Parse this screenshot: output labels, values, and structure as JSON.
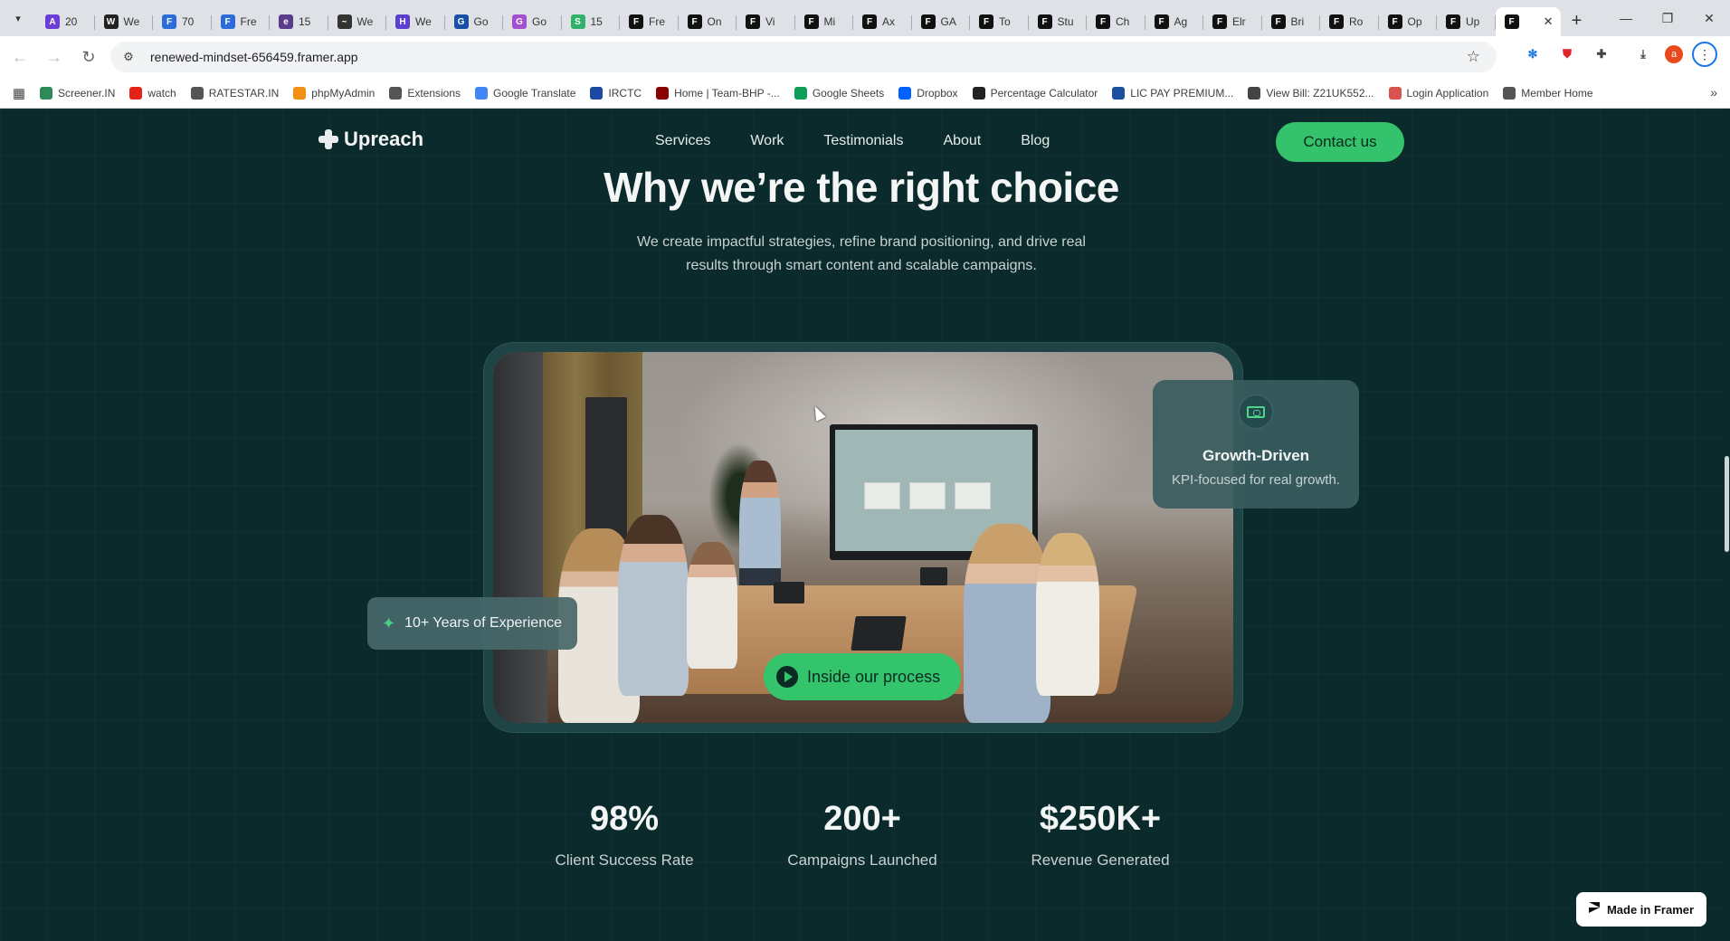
{
  "browser": {
    "tabs": [
      {
        "label": "20",
        "favicon": "A",
        "color": "#6b3fd6"
      },
      {
        "label": "We",
        "favicon": "W",
        "color": "#222222"
      },
      {
        "label": "70",
        "favicon": "F",
        "color": "#2b6cd9"
      },
      {
        "label": "Fre",
        "favicon": "F",
        "color": "#2b6cd9"
      },
      {
        "label": "15",
        "favicon": "e",
        "color": "#5a3c8a"
      },
      {
        "label": "We",
        "favicon": "~",
        "color": "#333333"
      },
      {
        "label": "We",
        "favicon": "H",
        "color": "#5b3fd0"
      },
      {
        "label": "Go",
        "favicon": "G",
        "color": "#1a4fa8"
      },
      {
        "label": "Go",
        "favicon": "G",
        "color": "#a24fd0"
      },
      {
        "label": "15",
        "favicon": "S",
        "color": "#2fb36a"
      },
      {
        "label": "Fre",
        "favicon": "F",
        "color": "#111111"
      },
      {
        "label": "On",
        "favicon": "F",
        "color": "#111111"
      },
      {
        "label": "Vi",
        "favicon": "F",
        "color": "#111111"
      },
      {
        "label": "Mi",
        "favicon": "F",
        "color": "#111111"
      },
      {
        "label": "Ax",
        "favicon": "F",
        "color": "#111111"
      },
      {
        "label": "GA",
        "favicon": "F",
        "color": "#111111"
      },
      {
        "label": "To",
        "favicon": "F",
        "color": "#111111"
      },
      {
        "label": "Stu",
        "favicon": "F",
        "color": "#111111"
      },
      {
        "label": "Ch",
        "favicon": "F",
        "color": "#111111"
      },
      {
        "label": "Ag",
        "favicon": "F",
        "color": "#111111"
      },
      {
        "label": "Elr",
        "favicon": "F",
        "color": "#111111"
      },
      {
        "label": "Bri",
        "favicon": "F",
        "color": "#111111"
      },
      {
        "label": "Ro",
        "favicon": "F",
        "color": "#111111"
      },
      {
        "label": "Op",
        "favicon": "F",
        "color": "#111111"
      },
      {
        "label": "Up",
        "favicon": "F",
        "color": "#111111"
      }
    ],
    "active_tab_favicon": "F",
    "url": "renewed-mindset-656459.framer.app",
    "profile_initial": "a",
    "bookmarks": [
      {
        "label": "Screener.IN",
        "icon": "bar-chart-icon",
        "color": "#2e8b57"
      },
      {
        "label": "watch",
        "icon": "youtube-icon",
        "color": "#e62117"
      },
      {
        "label": "RATESTAR.IN",
        "icon": "ratestar-icon",
        "color": "#555555"
      },
      {
        "label": "phpMyAdmin",
        "icon": "phpmyadmin-icon",
        "color": "#f29111"
      },
      {
        "label": "Extensions",
        "icon": "puzzle-icon",
        "color": "#555555"
      },
      {
        "label": "Google Translate",
        "icon": "translate-icon",
        "color": "#4285f4"
      },
      {
        "label": "IRCTC",
        "icon": "irctc-icon",
        "color": "#1b4aa0"
      },
      {
        "label": "Home | Team-BHP -...",
        "icon": "teambhp-icon",
        "color": "#8b0000"
      },
      {
        "label": "Google Sheets",
        "icon": "sheets-icon",
        "color": "#0f9d58"
      },
      {
        "label": "Dropbox",
        "icon": "dropbox-icon",
        "color": "#0061ff"
      },
      {
        "label": "Percentage Calculator",
        "icon": "calculator-icon",
        "color": "#222222"
      },
      {
        "label": "LIC PAY PREMIUM...",
        "icon": "lic-icon",
        "color": "#1d4fa0"
      },
      {
        "label": "View Bill: Z21UK552...",
        "icon": "bill-icon",
        "color": "#444444"
      },
      {
        "label": "Login Application",
        "icon": "login-icon",
        "color": "#d9534f"
      },
      {
        "label": "Member Home",
        "icon": "globe-icon",
        "color": "#555555"
      }
    ]
  },
  "site": {
    "logo": "Upreach",
    "nav": [
      "Services",
      "Work",
      "Testimonials",
      "About",
      "Blog"
    ],
    "contact": "Contact us",
    "headline": "Why we’re the right choice",
    "subtext_line1": "We create impactful strategies, refine brand positioning, and drive real",
    "subtext_line2": "results through smart content and scalable campaigns.",
    "growth_title": "Growth-Driven",
    "growth_sub": "KPI-focused for real growth.",
    "experience": "10+ Years of Experience",
    "process_button": "Inside our process",
    "stats": [
      {
        "value": "98%",
        "label": "Client Success Rate"
      },
      {
        "value": "200+",
        "label": "Campaigns Launched"
      },
      {
        "value": "$250K+",
        "label": "Revenue Generated"
      }
    ],
    "framer_badge": "Made in Framer",
    "accent": "#35c26c",
    "background": "#0b2a2c"
  }
}
